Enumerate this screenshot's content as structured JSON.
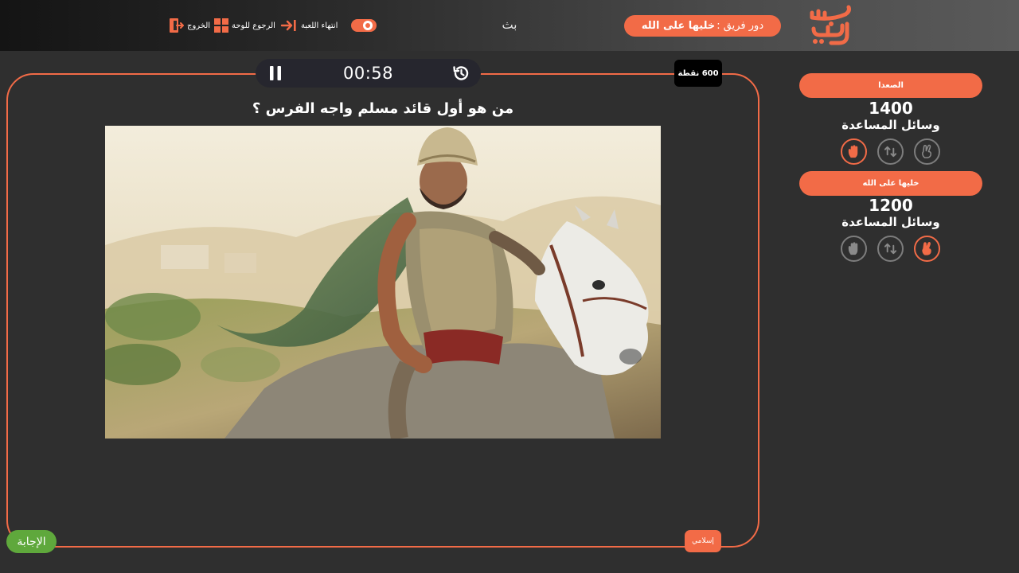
{
  "header": {
    "logo_text": "سين جيم",
    "turn_label": "دور فريق :",
    "turn_team": "خليها على الله",
    "letter": "بث",
    "end_game_label": "انتهاء اللعبة",
    "back_to_board_label": "الرجوع للوحة",
    "exit_label": "الخروج",
    "toggle_on": true
  },
  "timer": {
    "time": "00:58"
  },
  "question": {
    "points": "600 نقطة",
    "text": "من هو أول قائد مسلم واجه الفرس ؟",
    "category": "إسلامي",
    "answer_label": "الإجابة"
  },
  "teams": [
    {
      "name": "الصعدا",
      "score": "1400",
      "aids_label": "وسائل المساعدة",
      "aids": [
        {
          "icon": "hand-icon",
          "active": true
        },
        {
          "icon": "swap-icon",
          "active": false
        },
        {
          "icon": "two-fingers-icon",
          "active": false
        }
      ]
    },
    {
      "name": "خليها على الله",
      "score": "1200",
      "aids_label": "وسائل المساعدة",
      "aids": [
        {
          "icon": "hand-icon",
          "active": false
        },
        {
          "icon": "swap-icon",
          "active": false
        },
        {
          "icon": "two-fingers-icon",
          "active": true
        }
      ]
    }
  ],
  "colors": {
    "accent": "#f26b47",
    "answer": "#5fa83c",
    "background": "#2f2f2f"
  }
}
